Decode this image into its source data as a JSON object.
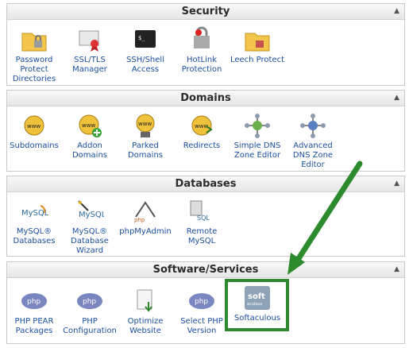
{
  "sections": [
    {
      "title": "Security",
      "items": [
        {
          "label": "Password Protect Directories",
          "icon": "folder-lock-icon"
        },
        {
          "label": "SSL/TLS Manager",
          "icon": "certificate-icon"
        },
        {
          "label": "SSH/Shell Access",
          "icon": "terminal-icon"
        },
        {
          "label": "HotLink Protection",
          "icon": "hotlink-icon"
        },
        {
          "label": "Leech Protect",
          "icon": "folder-leech-icon"
        }
      ]
    },
    {
      "title": "Domains",
      "items": [
        {
          "label": "Subdomains",
          "icon": "www-globe-icon"
        },
        {
          "label": "Addon Domains",
          "icon": "www-add-icon"
        },
        {
          "label": "Parked Domains",
          "icon": "www-parked-icon"
        },
        {
          "label": "Redirects",
          "icon": "www-redirect-icon"
        },
        {
          "label": "Simple DNS Zone Editor",
          "icon": "dns-zone-icon"
        },
        {
          "label": "Advanced DNS Zone Editor",
          "icon": "advanced-dns-icon"
        }
      ]
    },
    {
      "title": "Databases",
      "items": [
        {
          "label": "MySQL® Databases",
          "icon": "mysql-icon"
        },
        {
          "label": "MySQL® Database Wizard",
          "icon": "mysql-wizard-icon"
        },
        {
          "label": "phpMyAdmin",
          "icon": "phpmyadmin-icon"
        },
        {
          "label": "Remote MySQL",
          "icon": "remote-mysql-icon"
        }
      ]
    },
    {
      "title": "Software/Services",
      "items": [
        {
          "label": "PHP PEAR Packages",
          "icon": "php-icon"
        },
        {
          "label": "PHP Configuration",
          "icon": "php-icon"
        },
        {
          "label": "Optimize Website",
          "icon": "optimize-icon"
        },
        {
          "label": "Select PHP Version",
          "icon": "php-icon"
        },
        {
          "label": "Softaculous",
          "icon": "softaculous-icon"
        }
      ]
    }
  ],
  "colors": {
    "link": "#1a4fa0",
    "highlight": "#2d8a2d",
    "php": "#7a86c0"
  }
}
